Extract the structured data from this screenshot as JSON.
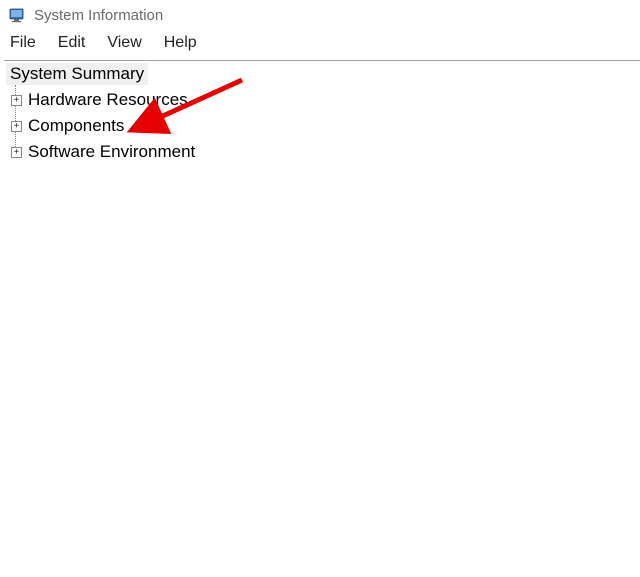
{
  "titlebar": {
    "title": "System Information"
  },
  "menubar": {
    "items": [
      {
        "label": "File"
      },
      {
        "label": "Edit"
      },
      {
        "label": "View"
      },
      {
        "label": "Help"
      }
    ]
  },
  "tree": {
    "root_label": "System Summary",
    "items": [
      {
        "label": "Hardware Resources",
        "expandable": true
      },
      {
        "label": "Components",
        "expandable": true
      },
      {
        "label": "Software Environment",
        "expandable": true
      }
    ]
  },
  "annotation": {
    "arrow_color": "#e60000"
  }
}
